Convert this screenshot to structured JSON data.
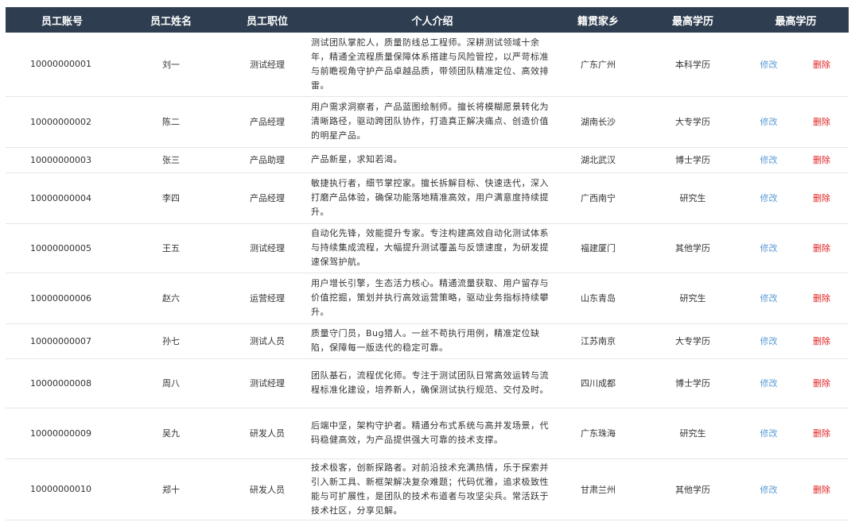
{
  "columns": [
    "员工账号",
    "员工姓名",
    "员工职位",
    "个人介绍",
    "籍贯家乡",
    "最高学历",
    "最高学历"
  ],
  "actions": {
    "edit": "修改",
    "delete": "删除"
  },
  "rows": [
    {
      "id": "10000000001",
      "name": "刘一",
      "position": "测试经理",
      "intro": "测试团队掌舵人，质量防线总工程师。深耕测试领域十余年，精通全流程质量保障体系搭建与风险管控，以严苛标准与前瞻视角守护产品卓越品质，带领团队精准定位、高效排雷。",
      "hometown": "广东广州",
      "education": "本科学历"
    },
    {
      "id": "10000000002",
      "name": "陈二",
      "position": "产品经理",
      "intro": "用户需求洞察者，产品蓝图绘制师。擅长将模糊愿景转化为清晰路径，驱动跨团队协作，打造真正解决痛点、创造价值的明星产品。",
      "hometown": "湖南长沙",
      "education": "大专学历"
    },
    {
      "id": "10000000003",
      "name": "张三",
      "position": "产品助理",
      "intro": "产品新星，求知若渴。",
      "hometown": "湖北武汉",
      "education": "博士学历"
    },
    {
      "id": "10000000004",
      "name": "李四",
      "position": "产品经理",
      "intro": "敏捷执行者，细节掌控家。擅长拆解目标、快速迭代，深入打磨产品体验，确保功能落地精准高效，用户满意度持续提升。",
      "hometown": "广西南宁",
      "education": "研究生"
    },
    {
      "id": "10000000005",
      "name": "王五",
      "position": "测试经理",
      "intro": "自动化先锋，效能提升专家。专注构建高效自动化测试体系与持续集成流程，大幅提升测试覆盖与反馈速度，为研发提速保驾护航。",
      "hometown": "福建厦门",
      "education": "其他学历"
    },
    {
      "id": "10000000006",
      "name": "赵六",
      "position": "运营经理",
      "intro": "用户增长引擎，生态活力核心。精通流量获取、用户留存与价值挖掘，策划并执行高效运营策略，驱动业务指标持续攀升。",
      "hometown": "山东青岛",
      "education": "研究生"
    },
    {
      "id": "10000000007",
      "name": "孙七",
      "position": "测试人员",
      "intro": "质量守门员，Bug猎人。一丝不苟执行用例，精准定位缺陷，保障每一版迭代的稳定可靠。",
      "hometown": "江苏南京",
      "education": "大专学历"
    },
    {
      "id": "10000000008",
      "name": "周八",
      "position": "测试经理",
      "intro": "团队基石，流程优化师。专注于测试团队日常高效运转与流程标准化建设，培养新人，确保测试执行规范、交付及时。",
      "hometown": "四川成都",
      "education": "博士学历"
    },
    {
      "id": "10000000009",
      "name": "吴九",
      "position": "研发人员",
      "intro": "后端中坚，架构守护者。精通分布式系统与高并发场景，代码稳健高效，为产品提供强大可靠的技术支撑。",
      "hometown": "广东珠海",
      "education": "研究生"
    },
    {
      "id": "10000000010",
      "name": "郑十",
      "position": "研发人员",
      "intro": "技术极客，创新探路者。对前沿技术充满热情，乐于探索并引入新工具、新框架解决复杂难题；代码优雅，追求极致性能与可扩展性，是团队的技术布道者与攻坚尖兵。常活跃于技术社区，分享见解。",
      "hometown": "甘肃兰州",
      "education": "其他学历"
    }
  ]
}
